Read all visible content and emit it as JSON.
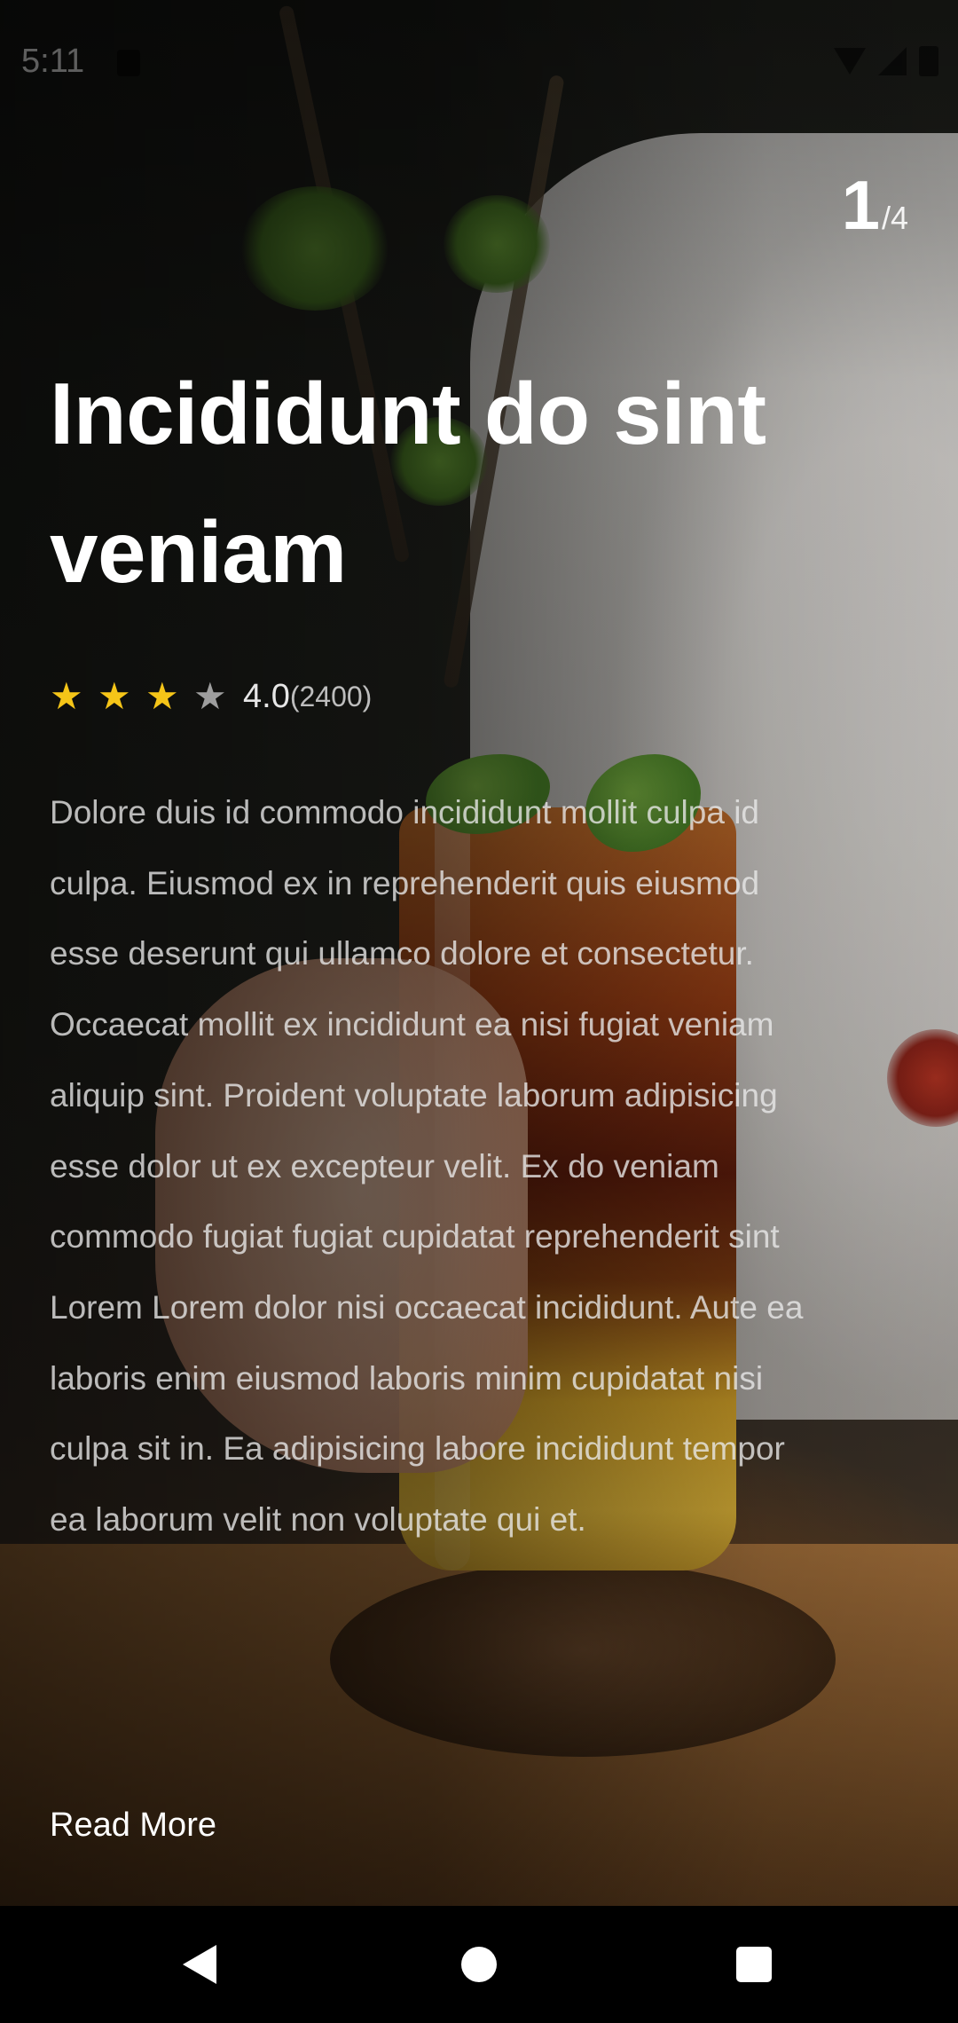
{
  "status_bar": {
    "time": "5:11"
  },
  "counter": {
    "current": "1",
    "total": "/4"
  },
  "article": {
    "title": "Incididunt do sint veniam",
    "rating": {
      "stars_filled": 3,
      "stars_total": 4,
      "value": "4.0",
      "count": "(2400)",
      "star_color": "#f5c518"
    },
    "description": "Dolore duis id commodo incididunt mollit culpa id culpa. Eiusmod ex in reprehenderit quis eiusmod esse deserunt qui ullamco dolore et consectetur. Occaecat mollit ex incididunt ea nisi fugiat veniam aliquip sint. Proident voluptate laborum adipisicing esse dolor ut ex excepteur velit. Ex do veniam commodo fugiat fugiat cupidatat reprehenderit sint Lorem Lorem dolor nisi occaecat incididunt. Aute ea laboris enim eiusmod laboris minim cupidatat nisi culpa sit in. Ea adipisicing labore incididunt tempor ea laborum velit non voluptate qui et.",
    "read_more_label": "Read More"
  },
  "background": {
    "subject": "cocktail-photo"
  },
  "nav_bar": {
    "icons": [
      "back-icon",
      "home-icon",
      "recents-icon"
    ]
  }
}
